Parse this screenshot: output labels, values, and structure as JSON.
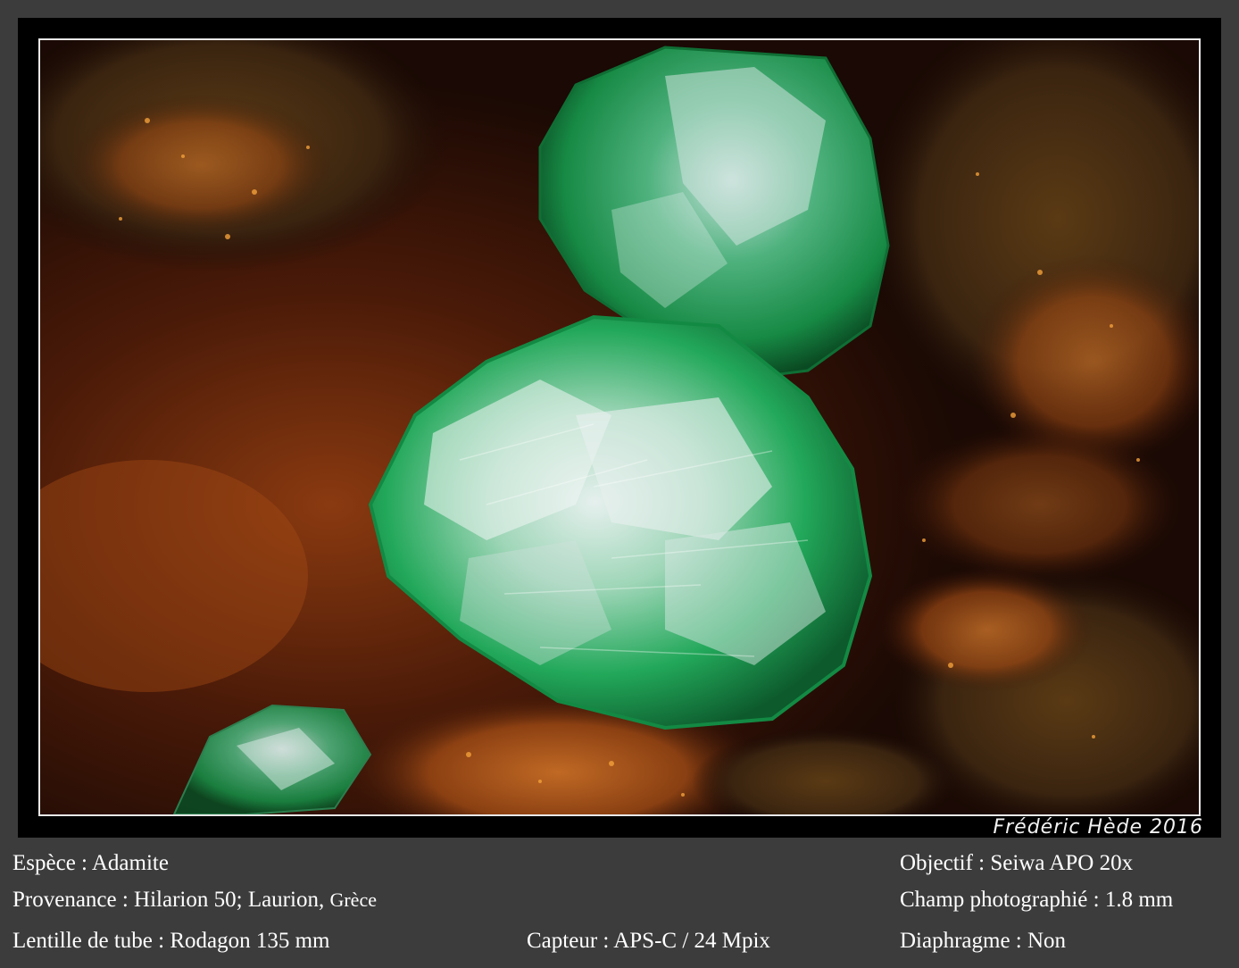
{
  "signature": "Frédéric Hède 2016",
  "caption": {
    "espece": "Espèce : Adamite",
    "provenance_main": "Provenance : Hilarion 50; Laurion,",
    "provenance_country": "Grèce",
    "lentille": "Lentille de tube : Rodagon 135 mm",
    "capteur": "Capteur : APS-C / 24 Mpix",
    "objectif": "Objectif : Seiwa APO 20x",
    "champ": "Champ photographié : 1.8 mm",
    "diaphragme": "Diaphragme : Non"
  },
  "colors": {
    "background": "#3c3c3c",
    "crystal_green": "#1fae5a",
    "matrix_orange": "#c8641e"
  }
}
